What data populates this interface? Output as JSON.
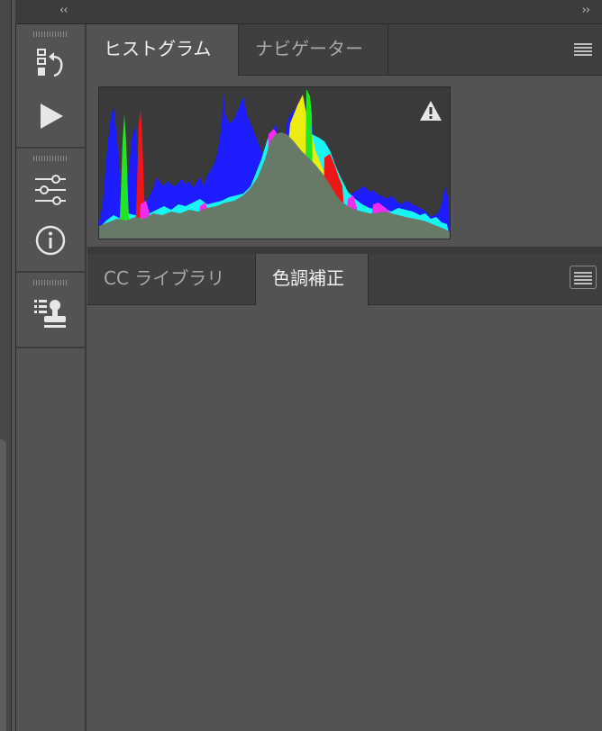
{
  "topbar": {
    "collapse_left": "‹‹",
    "collapse_right": "››"
  },
  "dock": {
    "items": [
      {
        "name": "history",
        "icon": "history-icon"
      },
      {
        "name": "actions",
        "icon": "play-icon"
      },
      {
        "name": "adjustments",
        "icon": "sliders-icon"
      },
      {
        "name": "info",
        "icon": "info-icon"
      },
      {
        "name": "clone-source",
        "icon": "clone-stamp-icon"
      }
    ]
  },
  "upper_panel": {
    "tabs": [
      {
        "label": "ヒストグラム",
        "active": true
      },
      {
        "label": "ナビゲーター",
        "active": false
      }
    ],
    "warning_icon": "warning-icon",
    "menu_icon": "panel-menu-icon",
    "histogram": {
      "channels": [
        "red",
        "green",
        "blue",
        "luminosity"
      ],
      "colors": {
        "background": "#3a3a3a",
        "luminosity": "#677a67",
        "blue": "#1c1cff",
        "cyan": "#18f4f4",
        "green": "#22e622",
        "red": "#ee1616",
        "yellow": "#ecec12",
        "magenta": "#f02cf0"
      }
    }
  },
  "lower_panel": {
    "tabs": [
      {
        "label": "CC ライブラリ",
        "active": false
      },
      {
        "label": "色調補正",
        "active": true
      }
    ],
    "menu_icon": "panel-menu-icon"
  },
  "colors": {
    "panel_bg": "#535353",
    "tabbar_bg": "#3f3f3f",
    "text_active": "#f0f0f0",
    "text_inactive": "#a8a8a8"
  }
}
